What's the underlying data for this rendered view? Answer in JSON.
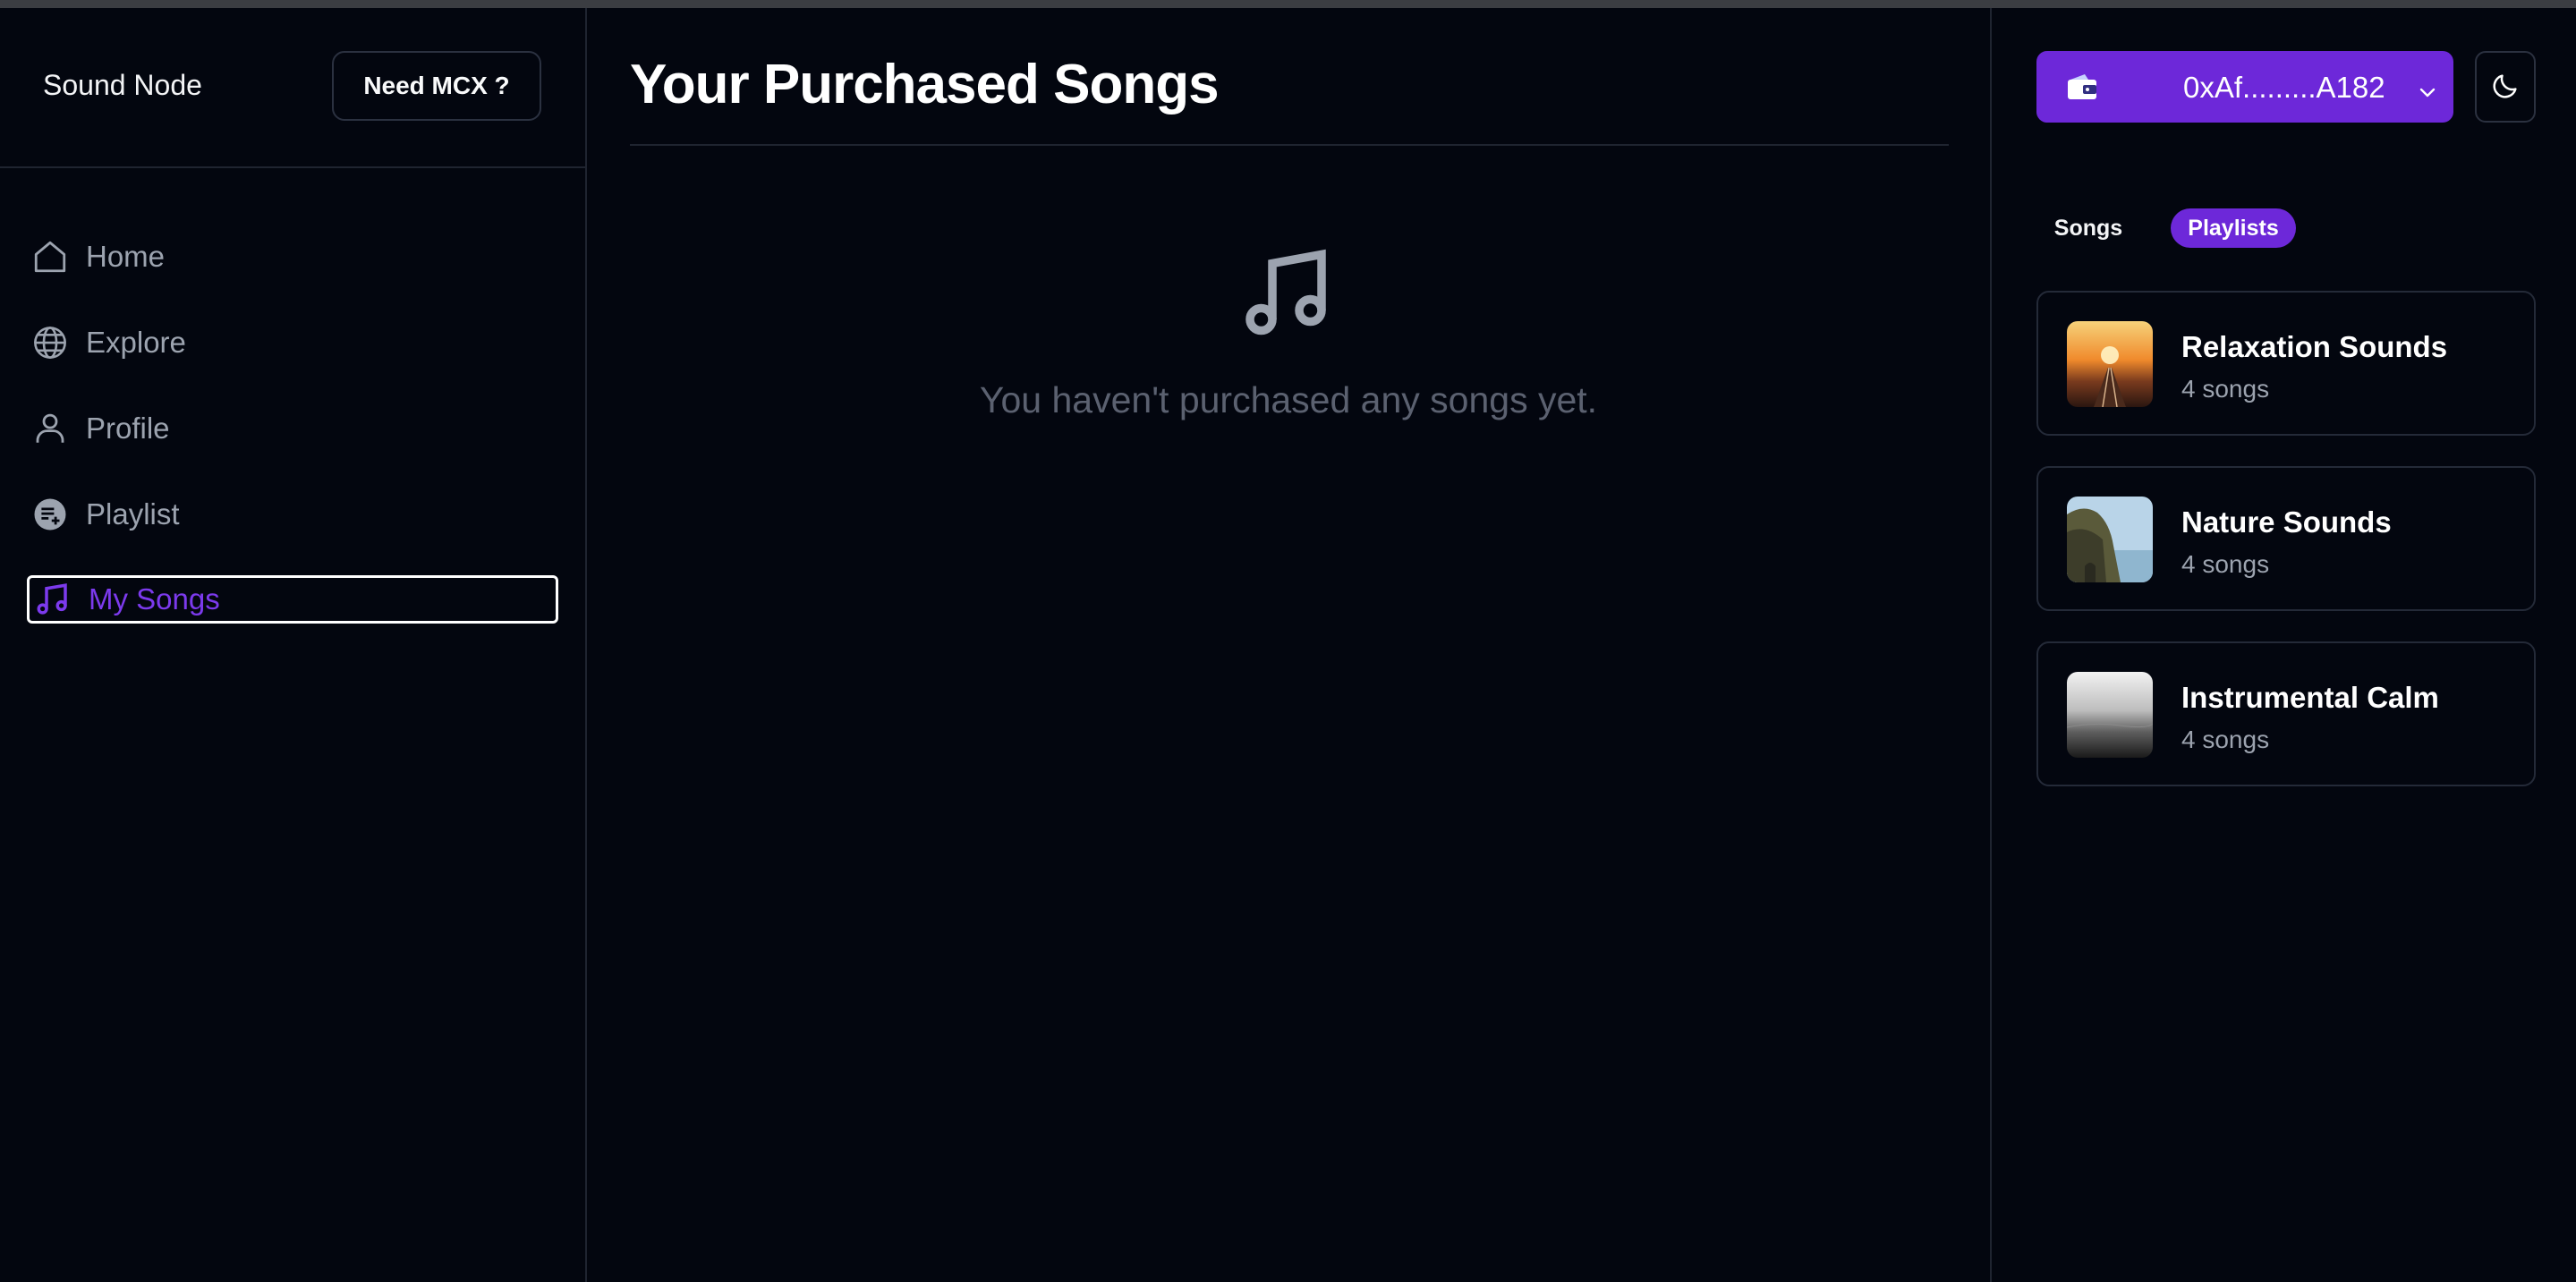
{
  "sidebar": {
    "brand": "Sound Node",
    "need_button": "Need MCX ?",
    "items": [
      {
        "label": "Home",
        "icon": "home-icon"
      },
      {
        "label": "Explore",
        "icon": "globe-icon"
      },
      {
        "label": "Profile",
        "icon": "user-icon"
      },
      {
        "label": "Playlist",
        "icon": "playlist-add-icon"
      },
      {
        "label": "My Songs",
        "icon": "music-note-icon",
        "active": true
      }
    ]
  },
  "main": {
    "title": "Your Purchased Songs",
    "empty_message": "You haven't purchased any songs yet."
  },
  "header": {
    "wallet_address": "0xAf.........A182",
    "wallet_icon": "wallet-icon",
    "theme_icon": "moon-icon"
  },
  "right_panel": {
    "tabs": [
      {
        "label": "Songs",
        "active": false
      },
      {
        "label": "Playlists",
        "active": true
      }
    ],
    "playlists": [
      {
        "name": "Relaxation Sounds",
        "count": "4 songs"
      },
      {
        "name": "Nature Sounds",
        "count": "4 songs"
      },
      {
        "name": "Instrumental Calm",
        "count": "4 songs"
      }
    ]
  },
  "colors": {
    "background": "#03060f",
    "accent": "#6d28d9",
    "active_text": "#7c3aed",
    "muted_text": "#9ca3af"
  }
}
